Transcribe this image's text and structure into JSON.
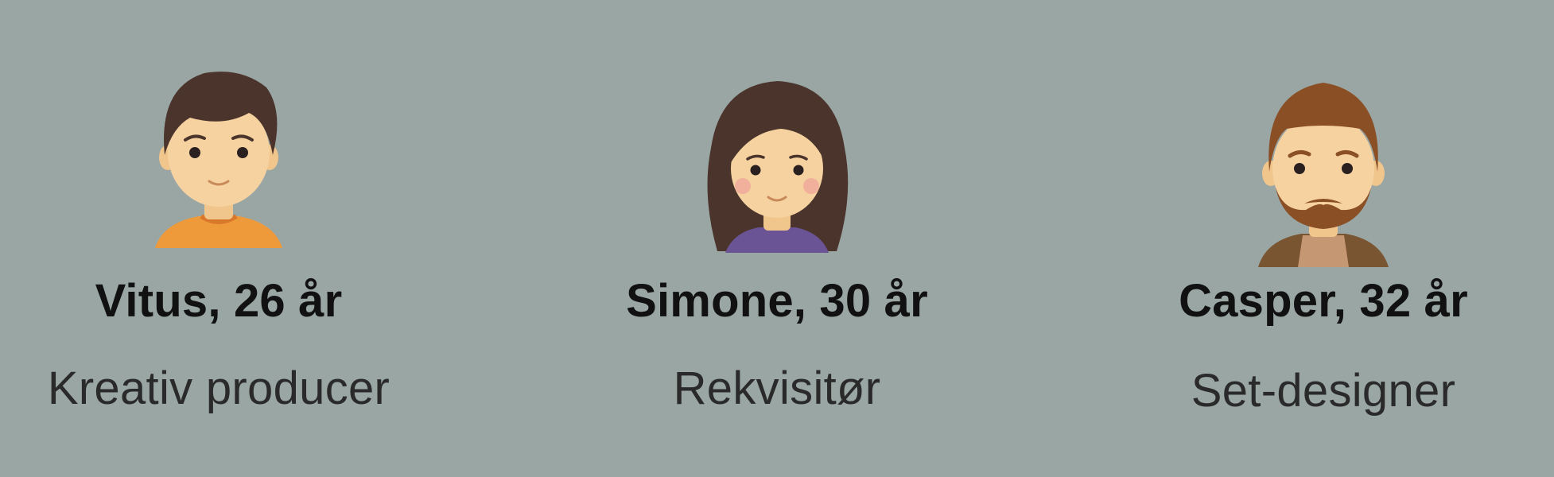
{
  "personas": [
    {
      "name_age": "Vitus, 26 år",
      "role": "Kreativ producer",
      "avatar_icon": "male-avatar-icon",
      "shirt_color": "#ee9a3a"
    },
    {
      "name_age": "Simone, 30 år",
      "role": "Rekvisitør",
      "avatar_icon": "female-avatar-icon",
      "shirt_color": "#6b5495"
    },
    {
      "name_age": "Casper, 32 år",
      "role": "Set-designer",
      "avatar_icon": "bearded-male-avatar-icon",
      "shirt_color": "#7a5532"
    }
  ],
  "colors": {
    "background": "#9aa6a4",
    "skin": "#f6d2a0",
    "hair_dark": "#4a342b",
    "hair_brown": "#8a4f25"
  }
}
